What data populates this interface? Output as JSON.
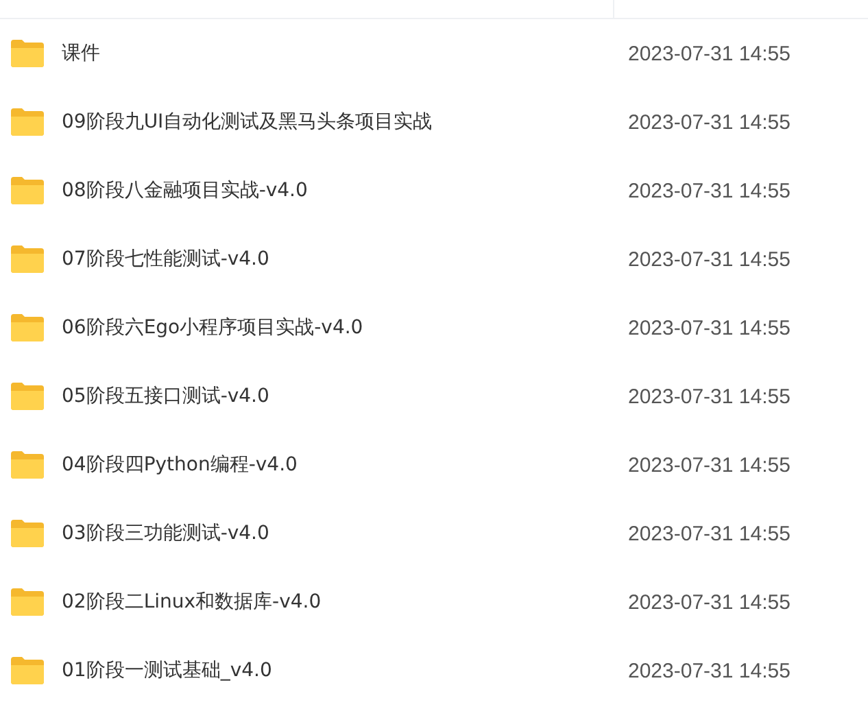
{
  "files": [
    {
      "name": "课件",
      "modified": "2023-07-31 14:55"
    },
    {
      "name": "09阶段九UI自动化测试及黑马头条项目实战",
      "modified": "2023-07-31 14:55"
    },
    {
      "name": "08阶段八金融项目实战-v4.0",
      "modified": "2023-07-31 14:55"
    },
    {
      "name": "07阶段七性能测试-v4.0",
      "modified": "2023-07-31 14:55"
    },
    {
      "name": "06阶段六Ego小程序项目实战-v4.0",
      "modified": "2023-07-31 14:55"
    },
    {
      "name": "05阶段五接口测试-v4.0",
      "modified": "2023-07-31 14:55"
    },
    {
      "name": "04阶段四Python编程-v4.0",
      "modified": "2023-07-31 14:55"
    },
    {
      "name": "03阶段三功能测试-v4.0",
      "modified": "2023-07-31 14:55"
    },
    {
      "name": "02阶段二Linux和数据库-v4.0",
      "modified": "2023-07-31 14:55"
    },
    {
      "name": "01阶段一测试基础_v4.0",
      "modified": "2023-07-31 14:55"
    }
  ]
}
